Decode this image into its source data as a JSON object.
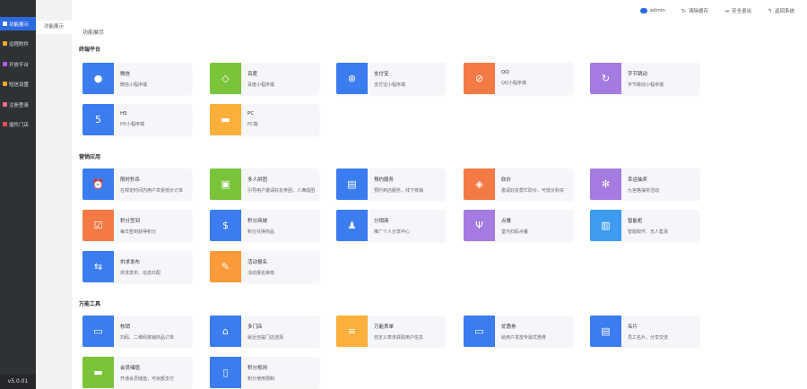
{
  "sidebar": {
    "items": [
      {
        "label": "功能展示",
        "color": "#ffffff",
        "active": true
      },
      {
        "label": "远程附件",
        "color": "#f5a623"
      },
      {
        "label": "开放平台",
        "color": "#b15cf0"
      },
      {
        "label": "短信设置",
        "color": "#f5a623"
      },
      {
        "label": "注册登录",
        "color": "#f36c8a"
      },
      {
        "label": "插件门店",
        "color": "#f05050"
      }
    ],
    "version": "v5.0.01"
  },
  "subnav": {
    "active": "功能展示"
  },
  "topbar": {
    "user": "admin",
    "clear_cache": "清除缓存",
    "logout": "安全退出",
    "back": "返回系统"
  },
  "page_title": "功能展示",
  "sections": [
    {
      "title": "终端平台",
      "cards": [
        {
          "name": "微信",
          "desc": "微信小程序端",
          "color": "#3b7cf0",
          "icon": "wechat-icon",
          "glyph": "●"
        },
        {
          "name": "百度",
          "desc": "百度小程序端",
          "color": "#7ac43a",
          "icon": "baidu-icon",
          "glyph": "◇"
        },
        {
          "name": "支付宝",
          "desc": "支付宝小程序端",
          "color": "#3b7cf0",
          "icon": "alipay-icon",
          "glyph": "⊗"
        },
        {
          "name": "QQ",
          "desc": "QQ小程序端",
          "color": "#f47a45",
          "icon": "qq-icon",
          "glyph": "⊘"
        },
        {
          "name": "字节跳动",
          "desc": "字节跳动小程序端",
          "color": "#a47be0",
          "icon": "bytedance-icon",
          "glyph": "↻"
        },
        {
          "name": "H5",
          "desc": "H5小程序端",
          "color": "#3b7cf0",
          "icon": "html5-icon",
          "glyph": "5"
        },
        {
          "name": "PC",
          "desc": "PC端",
          "color": "#fbb03b",
          "icon": "monitor-icon",
          "glyph": "▬"
        }
      ]
    },
    {
      "title": "营销应用",
      "cards": [
        {
          "name": "限时秒杀",
          "desc": "在规定时间内用户享受低价订单",
          "color": "#3b7cf0",
          "icon": "alarm-clock-icon",
          "glyph": "⏰"
        },
        {
          "name": "多人拼团",
          "desc": "引导用户邀请好友参团，人满成团",
          "color": "#7ac43a",
          "icon": "group-bag-icon",
          "glyph": "▣"
        },
        {
          "name": "预约服务",
          "desc": "预约到店服务，线下核销",
          "color": "#3b7cf0",
          "icon": "calendar-check-icon",
          "glyph": "▤"
        },
        {
          "name": "砍价",
          "desc": "邀请好友帮忙砍价，可低价购买",
          "color": "#f47a45",
          "icon": "price-tag-icon",
          "glyph": "◈"
        },
        {
          "name": "幸运抽奖",
          "desc": "九宫格抽奖活动",
          "color": "#a47be0",
          "icon": "lottery-wheel-icon",
          "glyph": "✻"
        },
        {
          "name": "积分签到",
          "desc": "每日签到获得积分",
          "color": "#f47a45",
          "icon": "calendar-icon",
          "glyph": "☑"
        },
        {
          "name": "积分商城",
          "desc": "积分兑换商品",
          "color": "#3b7cf0",
          "icon": "coin-icon",
          "glyph": "$"
        },
        {
          "name": "分销商",
          "desc": "推广个人分享中心",
          "color": "#3b7cf0",
          "icon": "users-icon",
          "glyph": "♟"
        },
        {
          "name": "点餐",
          "desc": "堂内扫码点餐",
          "color": "#a47be0",
          "icon": "fork-knife-icon",
          "glyph": "Ψ"
        },
        {
          "name": "智能柜",
          "desc": "智能取件、无人售货",
          "color": "#3d9bf0",
          "icon": "locker-icon",
          "glyph": "▥"
        },
        {
          "name": "供求发布",
          "desc": "供求发布、信息匹配",
          "color": "#3b7cf0",
          "icon": "exchange-icon",
          "glyph": "⇆"
        },
        {
          "name": "活动报名",
          "desc": "活动报名审核",
          "color": "#fb9a3b",
          "icon": "edit-form-icon",
          "glyph": "✎"
        }
      ]
    },
    {
      "title": "万能工具",
      "cards": [
        {
          "name": "核销",
          "desc": "扫码、二维码核销商品订单",
          "color": "#3b7cf0",
          "icon": "scan-icon",
          "glyph": "▭"
        },
        {
          "name": "多门店",
          "desc": "就近自提门店选择",
          "color": "#3b7cf0",
          "icon": "store-icon",
          "glyph": "⌂"
        },
        {
          "name": "万能表单",
          "desc": "自定义表单获取用户信息",
          "color": "#fbb03b",
          "icon": "form-icon",
          "glyph": "≡"
        },
        {
          "name": "优惠券",
          "desc": "给用户发放专属优惠券",
          "color": "#3b7cf0",
          "icon": "coupon-icon",
          "glyph": "▭"
        },
        {
          "name": "名片",
          "desc": "员工名片，分享交流",
          "color": "#3b7cf0",
          "icon": "id-card-icon",
          "glyph": "▤"
        },
        {
          "name": "会员储值",
          "desc": "开通会员储值，可余额支付",
          "color": "#7ac43a",
          "icon": "card-icon",
          "glyph": "▬"
        },
        {
          "name": "积分规则",
          "desc": "积分使用限制",
          "color": "#3b7cf0",
          "icon": "clipboard-icon",
          "glyph": "▯"
        }
      ]
    }
  ]
}
